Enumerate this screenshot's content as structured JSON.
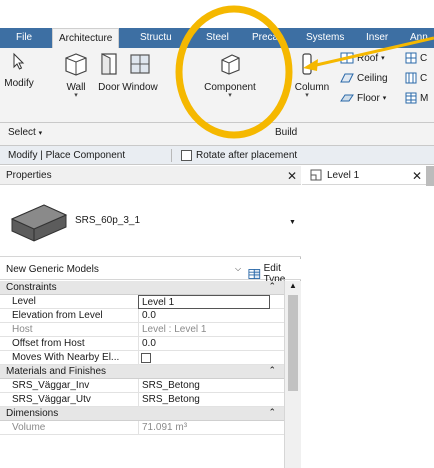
{
  "ribbon": {
    "tabs": [
      {
        "label": "File"
      },
      {
        "label": "Architecture"
      },
      {
        "label": "Structu"
      },
      {
        "label": "Steel"
      },
      {
        "label": "Preca"
      },
      {
        "label": "Systems"
      },
      {
        "label": "Inser"
      },
      {
        "label": "Ann"
      }
    ],
    "buttons": {
      "modify": "Modify",
      "wall": "Wall",
      "door": "Door",
      "window": "Window",
      "component": "Component",
      "column": "Column"
    },
    "small": {
      "roof": "Roof",
      "ceiling": "Ceiling",
      "floor": "Floor",
      "c1": "C",
      "c2": "C",
      "m": "M"
    },
    "panels": {
      "select": "Select",
      "build": "Build"
    },
    "accent": "#3d6fa3"
  },
  "options_bar": {
    "context": "Modify | Place Component",
    "rotate_label": "Rotate after placement"
  },
  "properties": {
    "title": "Properties",
    "type_name": "SRS_60p_3_1",
    "family_filter": "New Generic Models",
    "edit_type": "Edit Type",
    "groups": [
      {
        "label": "Constraints",
        "rows": [
          {
            "key": "Level",
            "value": "Level 1"
          },
          {
            "key": "Elevation from Level",
            "value": "0.0"
          },
          {
            "key": "Host",
            "value": "Level : Level 1"
          },
          {
            "key": "Offset from Host",
            "value": "0.0"
          },
          {
            "key": "Moves With Nearby El...",
            "value": ""
          }
        ]
      },
      {
        "label": "Materials and Finishes",
        "rows": [
          {
            "key": "SRS_Väggar_Inv",
            "value": "SRS_Betong"
          },
          {
            "key": "SRS_Väggar_Utv",
            "value": "SRS_Betong"
          }
        ]
      },
      {
        "label": "Dimensions",
        "rows": [
          {
            "key": "Volume",
            "value": "71.091 m³"
          }
        ]
      }
    ]
  },
  "view": {
    "tab_label": "Level 1"
  },
  "annotation": {
    "highlight_color": "#f5b800"
  }
}
